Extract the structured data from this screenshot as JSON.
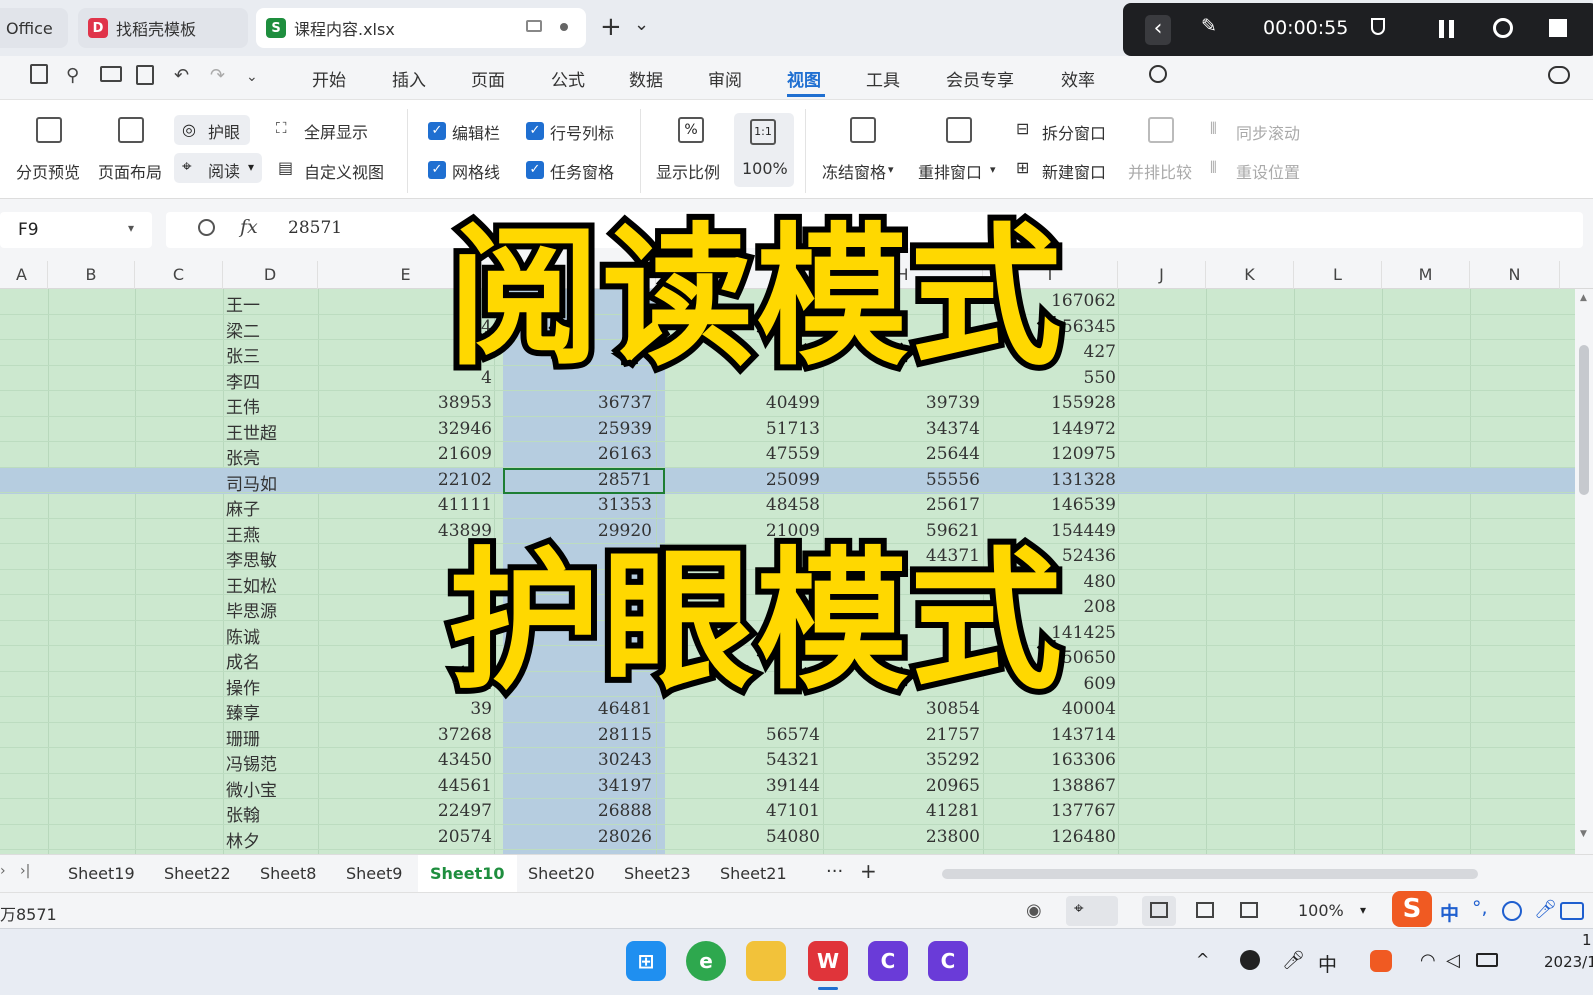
{
  "window": {
    "app_label": "Office",
    "tabs": [
      {
        "label": "找稻壳模板"
      },
      {
        "label": "课程内容.xlsx"
      }
    ],
    "new_tab": "+",
    "tab_menu": "⌄"
  },
  "recorder": {
    "back": "‹",
    "time": "00:00:55"
  },
  "menu": {
    "items": [
      "开始",
      "插入",
      "页面",
      "公式",
      "数据",
      "审阅",
      "视图",
      "工具",
      "会员专享",
      "效率"
    ],
    "active": "视图"
  },
  "ribbon": {
    "page_break_preview": "分页预览",
    "page_layout": "页面布局",
    "eye_protect": "护眼",
    "reading": "阅读",
    "fullscreen": "全屏显示",
    "custom_view": "自定义视图",
    "edit_bar": "编辑栏",
    "headings": "行号列标",
    "gridlines": "网格线",
    "task_pane": "任务窗格",
    "zoom": "显示比例",
    "zoom_100": "100%",
    "freeze": "冻结窗格",
    "arrange": "重排窗口",
    "split": "拆分窗口",
    "new_window": "新建窗口",
    "side_by_side": "并排比较",
    "sync_scroll": "同步滚动",
    "reset_pos": "重设位置"
  },
  "formula": {
    "cell_ref": "F9",
    "fx": "fx",
    "value": "28571"
  },
  "columns": [
    "A",
    "B",
    "C",
    "D",
    "E",
    "F",
    "G",
    "H",
    "I",
    "J",
    "K",
    "L",
    "M",
    "N"
  ],
  "rows": [
    {
      "name": "王一",
      "e": "3",
      "f": "",
      "g": "",
      "h": "",
      "i": "167062"
    },
    {
      "name": "梁二",
      "e": "4",
      "f": "",
      "g": "",
      "h": "",
      "i": "156345"
    },
    {
      "name": "张三",
      "e": "4",
      "f": "",
      "g": "",
      "h": "",
      "i": "427"
    },
    {
      "name": "李四",
      "e": "4",
      "f": "",
      "g": "",
      "h": "",
      "i": "550"
    },
    {
      "name": "王伟",
      "e": "38953",
      "f": "36737",
      "g": "40499",
      "h": "39739",
      "i": "155928"
    },
    {
      "name": "王世超",
      "e": "32946",
      "f": "25939",
      "g": "51713",
      "h": "34374",
      "i": "144972"
    },
    {
      "name": "张亮",
      "e": "21609",
      "f": "26163",
      "g": "47559",
      "h": "25644",
      "i": "120975"
    },
    {
      "name": "司马如",
      "e": "22102",
      "f": "28571",
      "g": "25099",
      "h": "55556",
      "i": "131328"
    },
    {
      "name": "麻子",
      "e": "41111",
      "f": "31353",
      "g": "48458",
      "h": "25617",
      "i": "146539"
    },
    {
      "name": "王燕",
      "e": "43899",
      "f": "29920",
      "g": "21009",
      "h": "59621",
      "i": "154449"
    },
    {
      "name": "李思敏",
      "e": "36",
      "f": "",
      "g": "",
      "h": "44371",
      "i": "52436"
    },
    {
      "name": "王如松",
      "e": "",
      "f": "",
      "g": "",
      "h": "",
      "i": "480"
    },
    {
      "name": "毕思源",
      "e": "4",
      "f": "",
      "g": "",
      "h": "",
      "i": "208"
    },
    {
      "name": "陈诚",
      "e": "",
      "f": "",
      "g": "",
      "h": "",
      "i": "141425"
    },
    {
      "name": "成名",
      "e": "40",
      "f": "",
      "g": "",
      "h": "",
      "i": "150650"
    },
    {
      "name": "操作",
      "e": "4",
      "f": "",
      "g": "",
      "h": "",
      "i": "609"
    },
    {
      "name": "臻享",
      "e": "39",
      "f": "46481",
      "g": "",
      "h": "30854",
      "i": "40004"
    },
    {
      "name": "珊珊",
      "e": "37268",
      "f": "28115",
      "g": "56574",
      "h": "21757",
      "i": "143714"
    },
    {
      "name": "冯锡范",
      "e": "43450",
      "f": "30243",
      "g": "54321",
      "h": "35292",
      "i": "163306"
    },
    {
      "name": "微小宝",
      "e": "44561",
      "f": "34197",
      "g": "39144",
      "h": "20965",
      "i": "138867"
    },
    {
      "name": "张翰",
      "e": "22497",
      "f": "26888",
      "g": "47101",
      "h": "41281",
      "i": "137767"
    },
    {
      "name": "林夕",
      "e": "20574",
      "f": "28026",
      "g": "54080",
      "h": "23800",
      "i": "126480"
    }
  ],
  "overlay": {
    "line1": "阅读模式",
    "line2": "护眼模式"
  },
  "sheets": [
    "Sheet19",
    "Sheet22",
    "Sheet8",
    "Sheet9",
    "Sheet10",
    "Sheet20",
    "Sheet23",
    "Sheet21"
  ],
  "active_sheet": "Sheet10",
  "sheet_more": "···",
  "sheet_add": "+",
  "status": {
    "left_text": "万8571",
    "zoom": "100%"
  },
  "ime": {
    "logo": "S",
    "lang": "中"
  },
  "taskbar": {
    "tray_lang": "中",
    "clock_top": "1",
    "clock_date": "2023/1"
  }
}
